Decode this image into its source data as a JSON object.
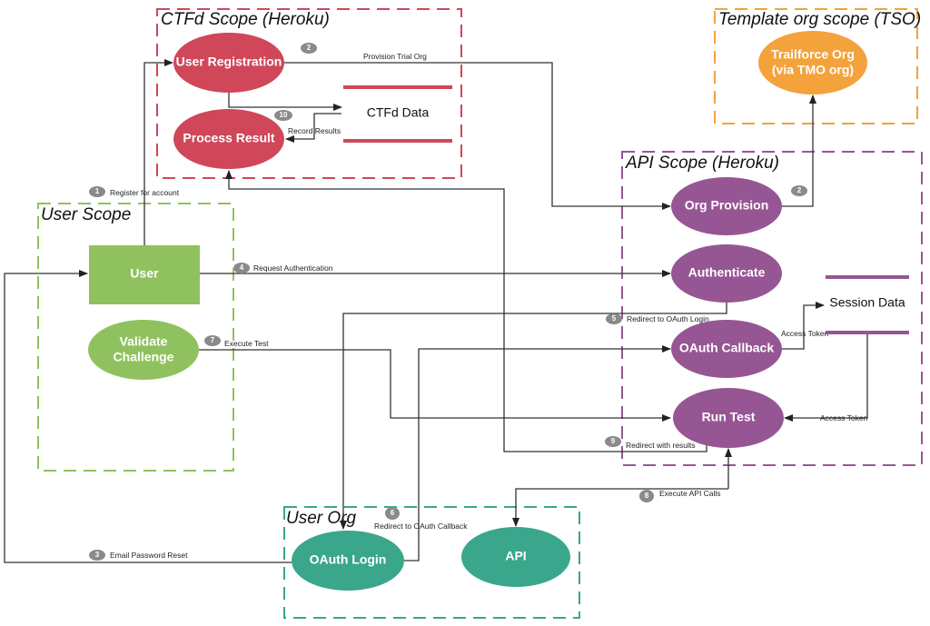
{
  "colors": {
    "ctfd": "#d0475a",
    "tso": "#f4a23c",
    "api": "#965694",
    "user": "#8fc25e",
    "user_org": "#3aa68c",
    "edge": "#333333",
    "badge": "#8a8a8a"
  },
  "scopes": {
    "ctfd": "CTFd Scope (Heroku)",
    "tso": "Template org scope (TSO)",
    "api": "API Scope (Heroku)",
    "user": "User Scope",
    "user_org": "User Org"
  },
  "nodes": {
    "user_registration": "User Registration",
    "process_result": "Process Result",
    "ctfd_data": "CTFd Data",
    "trailforce_line1": "Trailforce Org",
    "trailforce_line2": "(via TMO org)",
    "org_provision": "Org Provision",
    "authenticate": "Authenticate",
    "oauth_callback": "OAuth Callback",
    "run_test": "Run Test",
    "session_data": "Session Data",
    "user": "User",
    "validate_line1": "Validate",
    "validate_line2": "Challenge",
    "oauth_login": "OAuth Login",
    "api": "API"
  },
  "edges": {
    "register": {
      "step": "1",
      "label": "Register for account"
    },
    "provision_trial": {
      "step": "2",
      "label": "Provision Trial Org"
    },
    "provision_tso": {
      "step": "2"
    },
    "email_reset": {
      "step": "3",
      "label": "Email Password Reset"
    },
    "request_auth": {
      "step": "4",
      "label": "Request Authentication"
    },
    "redirect_login": {
      "step": "5",
      "label": "Redirect to OAuth Login"
    },
    "redirect_callback": {
      "step": "6",
      "label": "Redirect to OAuth Callback"
    },
    "execute_test": {
      "step": "7",
      "label": "Execute Test"
    },
    "execute_api": {
      "step": "8",
      "label": "Execute API Calls"
    },
    "redirect_results": {
      "step": "9",
      "label": "Redirect with results"
    },
    "record_results": {
      "step": "10",
      "label": "Record Results"
    },
    "access_token_store": {
      "label": "Access Token"
    },
    "access_token_read": {
      "label": "Access Token"
    }
  }
}
